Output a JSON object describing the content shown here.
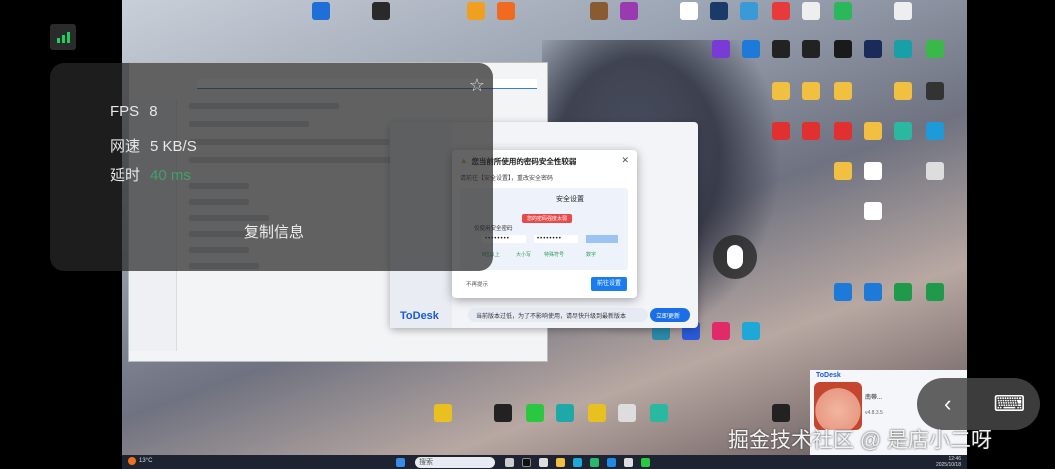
{
  "overlay": {
    "fps_label": "FPS",
    "fps_value": "8",
    "speed_label": "网速",
    "speed_value": "5 KB/S",
    "latency_label": "延时",
    "latency_value": "40 ms",
    "copy_label": "复制信息",
    "latency_color": "#2ecc71"
  },
  "dialog": {
    "title": "您当前所使用的密码安全性较弱",
    "subtitle": "请前往【安全设置】，重改安全密码",
    "panel_title": "安全设置",
    "warning": "您的密码强度太弱",
    "radio": "仅使用安全密码",
    "password1": "••••••••",
    "password2": "••••••••",
    "checks": [
      "8位以上",
      "大小写",
      "特殊符号",
      "数字"
    ],
    "no_show": "不再提示",
    "go_button": "前往设置"
  },
  "todesk": {
    "logo": "ToDesk",
    "notice": "当前版本过低，为了不影响使用，请尽快升级到最新版本",
    "update_button": "立即更新"
  },
  "card": {
    "brand": "ToDesk",
    "name": "南蒂...",
    "version": "v4.8.3.5"
  },
  "taskbar": {
    "weather": "13°C",
    "search_placeholder": "搜索",
    "time": "12:46",
    "date": "2025/10/18"
  },
  "controls": {
    "back_icon": "‹",
    "keyboard_icon": "⌨"
  },
  "watermark": "掘金技术社区 @ 是店小二呀"
}
